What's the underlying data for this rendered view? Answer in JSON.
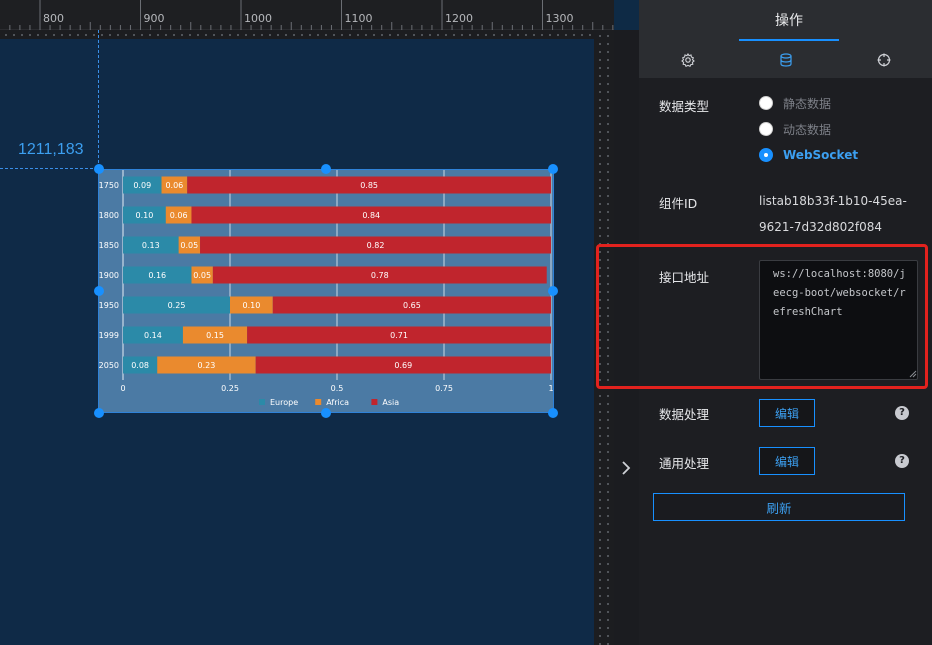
{
  "ruler": {
    "labels": [
      "800",
      "900",
      "1000",
      "1100",
      "1200",
      "1300"
    ]
  },
  "canvas": {
    "coordinate_readout": "1211,183"
  },
  "panel": {
    "title": "操作",
    "tabs": [
      {
        "icon": "gear-icon"
      },
      {
        "icon": "database-icon"
      },
      {
        "icon": "crosshair-icon"
      }
    ],
    "data_type": {
      "label": "数据类型",
      "options": [
        {
          "label": "静态数据",
          "selected": false
        },
        {
          "label": "动态数据",
          "selected": false
        },
        {
          "label": "WebSocket",
          "selected": true
        }
      ]
    },
    "component_id": {
      "label": "组件ID",
      "value": "listab18b33f-1b10-45ea-9621-7d32d802f084"
    },
    "endpoint": {
      "label": "接口地址",
      "value": "ws://localhost:8080/jeecg-boot/websocket/refreshChart"
    },
    "data_processing": {
      "label": "数据处理",
      "button": "编辑"
    },
    "general_processing": {
      "label": "通用处理",
      "button": "编辑"
    },
    "refresh_button": "刷新",
    "help_glyph": "?"
  },
  "colors": {
    "accent": "#1890ff",
    "highlight": "#e2221e",
    "europe": "#2b8aa8",
    "africa": "#ea8a2e",
    "asia": "#c0252d"
  },
  "chart_data": {
    "type": "bar",
    "orientation": "horizontal",
    "stacked": true,
    "categories": [
      "1750",
      "1800",
      "1850",
      "1900",
      "1950",
      "1999",
      "2050"
    ],
    "series": [
      {
        "name": "Europe",
        "values": [
          0.09,
          0.1,
          0.13,
          0.16,
          0.25,
          0.14,
          0.08
        ],
        "labels": [
          "0.09",
          "0.10",
          "0.13",
          "0.16",
          "0.25",
          "0.14",
          "0.08"
        ]
      },
      {
        "name": "Africa",
        "values": [
          0.06,
          0.06,
          0.05,
          0.05,
          0.1,
          0.15,
          0.23
        ],
        "labels": [
          "0.06",
          "0.06",
          "0.05",
          "0.05",
          "0.10",
          "0.15",
          "0.23"
        ]
      },
      {
        "name": "Asia",
        "values": [
          0.85,
          0.84,
          0.82,
          0.78,
          0.65,
          0.71,
          0.69
        ],
        "labels": [
          "0.85",
          "0.84",
          "0.82",
          "0.78",
          "0.65",
          "0.71",
          "0.69"
        ]
      }
    ],
    "xticks": [
      "0",
      "0.25",
      "0.5",
      "0.75",
      "1"
    ],
    "xlim": [
      0,
      1
    ],
    "legend_position": "bottom",
    "grid": true
  }
}
